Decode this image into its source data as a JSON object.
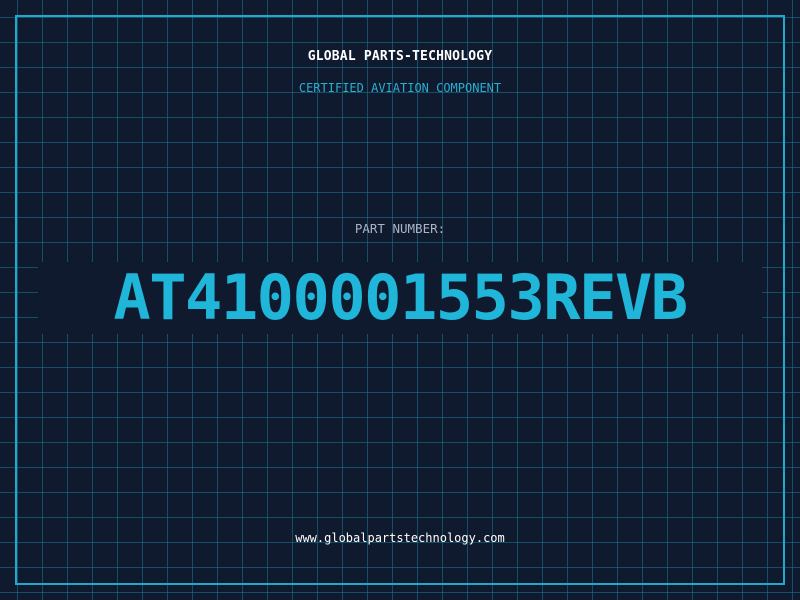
{
  "header": {
    "brand": "GLOBAL PARTS-TECHNOLOGY",
    "tagline": "CERTIFIED AVIATION COMPONENT"
  },
  "part": {
    "label": "PART NUMBER:",
    "number": "AT4100001553REVB"
  },
  "footer": {
    "website": "www.globalpartstechnology.com"
  },
  "colors": {
    "background": "#0f1a2e",
    "grid": "#1c7896",
    "frame": "#22a8c8",
    "accent": "#1fb6d9",
    "label": "#a9b3c4",
    "text": "#ffffff"
  }
}
